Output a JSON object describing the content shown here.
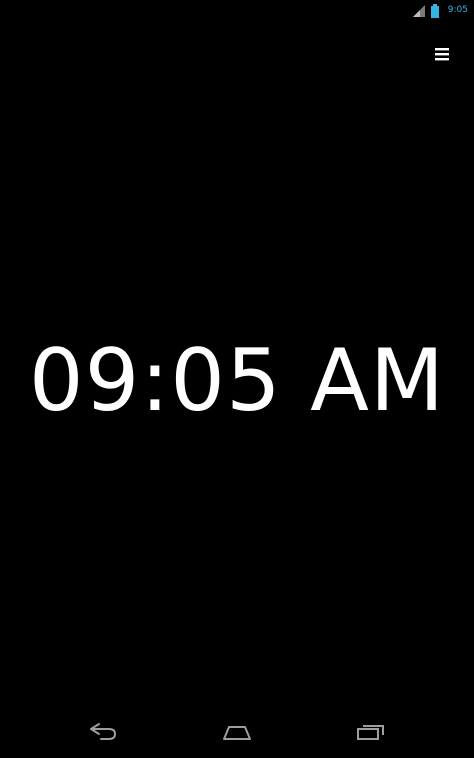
{
  "status_bar": {
    "time": "9:05",
    "icons": [
      "signal-icon",
      "battery-icon"
    ],
    "accent_color": "#33b5e5"
  },
  "header": {
    "menu_icon": "overflow-menu-icon"
  },
  "clock": {
    "display_time": "09:05 AM",
    "text_color": "#ffffff",
    "background_color": "#000000"
  },
  "nav_bar": {
    "buttons": [
      "back-icon",
      "home-icon",
      "recent-apps-icon"
    ]
  }
}
